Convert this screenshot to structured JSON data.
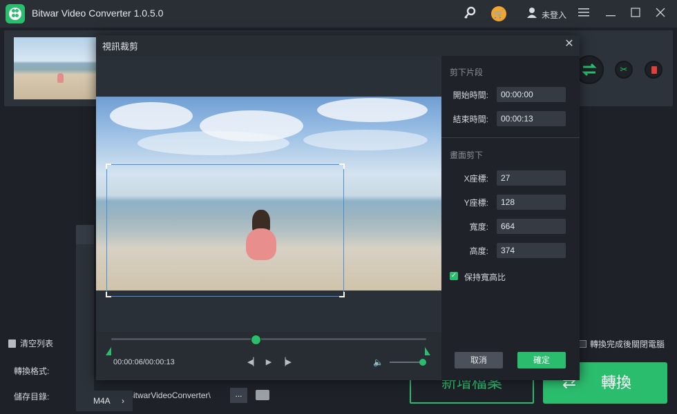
{
  "app": {
    "title": "Bitwar Video Converter  1.0.5.0",
    "login_label": "未登入",
    "accent_color": "#2bbd6e"
  },
  "titlebar_icons": [
    "key-icon",
    "cart-icon",
    "user-icon",
    "menu-icon",
    "minimize-icon",
    "maximize-icon",
    "close-icon"
  ],
  "file_list": {
    "clear_label": "清空列表",
    "shutdown_label": "轉換完成後關閉電腦"
  },
  "bottom": {
    "format_label": "轉換格式:",
    "save_label": "儲存目錄:",
    "path_value": "BitwarVideoConverter\\",
    "browse_label": "...",
    "add_file_label": "新增檔案",
    "convert_label": "轉換",
    "format_menu_item": "M4A"
  },
  "dialog": {
    "title": "視訊裁剪",
    "cut_section": {
      "title": "剪下片段",
      "start_label": "開始時間:",
      "start_value": "00:00:00",
      "end_label": "結束時間:",
      "end_value": "00:00:13"
    },
    "crop_section": {
      "title": "畫面剪下",
      "x_label": "X座標:",
      "x_value": "27",
      "y_label": "Y座標:",
      "y_value": "128",
      "w_label": "寬度:",
      "w_value": "664",
      "h_label": "高度:",
      "h_value": "374"
    },
    "keep_ratio_label": "保持寬高比",
    "keep_ratio_checked": true,
    "time_readout": "00:00:06/00:00:13",
    "playhead_fraction": 0.46,
    "volume_fraction": 1.0,
    "cancel_label": "取消",
    "ok_label": "確定"
  }
}
